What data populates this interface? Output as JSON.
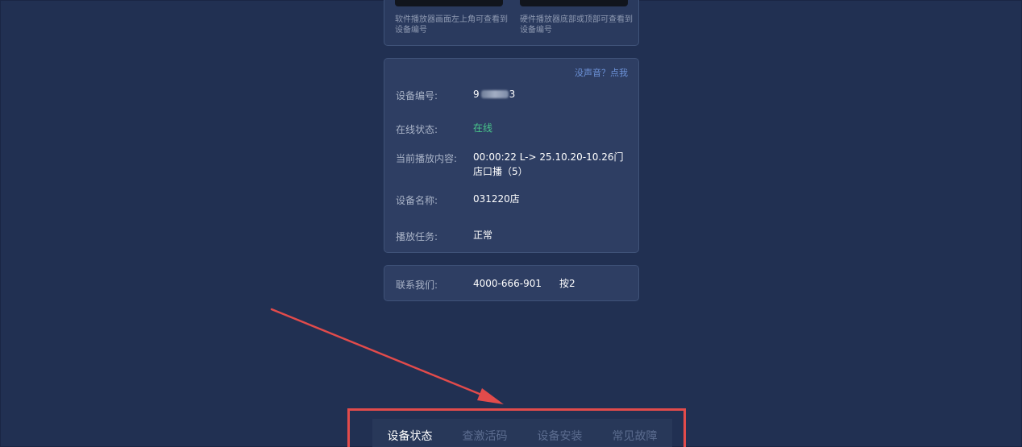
{
  "top_card": {
    "software_hint": "软件播放器画面左上角可查看到设备编号",
    "hardware_hint": "硬件播放器底部或顶部可查看到设备编号"
  },
  "info_card": {
    "no_sound_link": "没声音？点我",
    "device_id_label": "设备编号:",
    "device_id_prefix": "9",
    "device_id_suffix": "3",
    "online_status_label": "在线状态:",
    "online_status_value": "在线",
    "playing_label": "当前播放内容:",
    "playing_value": "00:00:22 L-> 25.10.20-10.26门店口播（5）",
    "device_name_label": "设备名称:",
    "device_name_value": "031220店",
    "task_label": "播放任务:",
    "task_value": "正常"
  },
  "contact_card": {
    "label": "联系我们:",
    "phone": "4000-666-901",
    "press": "按2"
  },
  "tabs": [
    {
      "label": "设备状态",
      "active": true
    },
    {
      "label": "查激活码",
      "active": false
    },
    {
      "label": "设备安装",
      "active": false
    },
    {
      "label": "常见故障",
      "active": false
    }
  ],
  "colors": {
    "background": "#213052",
    "card": "#2e3e63",
    "online": "#49c78b",
    "link": "#6d93d9",
    "highlight": "#e24b4b"
  }
}
